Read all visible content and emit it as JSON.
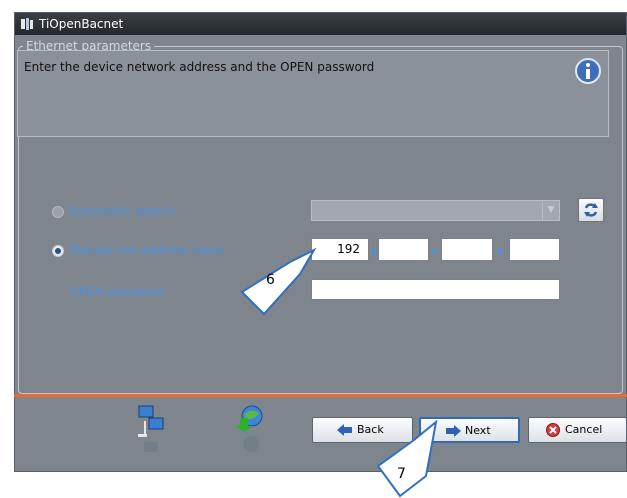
{
  "window": {
    "title": "TiOpenBacnet"
  },
  "group": {
    "legend": "Ethernet parameters"
  },
  "info": {
    "text": "Enter the device network address and the OPEN password",
    "icon": "info-icon"
  },
  "options": {
    "automatic_label": "Automatic search",
    "manual_label": "Manual net-address input",
    "password_label": "OPEN password",
    "selected": "manual"
  },
  "ip": {
    "octet1": "192",
    "octet2": "",
    "octet3": "",
    "octet4": ""
  },
  "buttons": {
    "back": "Back",
    "next": "Next",
    "cancel": "Cancel"
  },
  "callouts": {
    "first": "6",
    "second": "7"
  },
  "colors": {
    "accent_label": "#4a90e2",
    "footer_line": "#ec6a2c",
    "panel": "#7e858d"
  }
}
